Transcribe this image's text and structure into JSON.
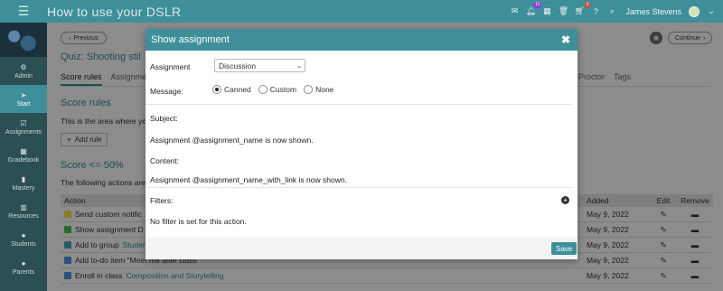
{
  "topbar": {
    "menu_icon": "hamburger-icon",
    "title": "How to use your DSLR",
    "mail_icon": "mail-icon",
    "notif_count": "11",
    "cart_count": "2",
    "user_name": "James Stevens"
  },
  "sidebar": {
    "items": [
      {
        "label": "Admin",
        "icon": "gear-icon"
      },
      {
        "label": "Start",
        "icon": "arrow-icon"
      },
      {
        "label": "Assignments",
        "icon": "checklist-icon"
      },
      {
        "label": "Gradebook",
        "icon": "grid-icon"
      },
      {
        "label": "Mastery",
        "icon": "bars-icon"
      },
      {
        "label": "Resources",
        "icon": "books-icon"
      },
      {
        "label": "Students",
        "icon": "person-icon"
      },
      {
        "label": "Parents",
        "icon": "person-icon"
      }
    ]
  },
  "main": {
    "prev_label": "Previous",
    "continue_label": "Continue",
    "quiz_title": "Quiz: Shooting stil",
    "tabs_left": [
      "Score rules",
      "Assignme"
    ],
    "tabs_right": [
      "Proctor",
      "Tags"
    ],
    "score_rules_title": "Score rules",
    "score_rules_desc": "This is the area where yo",
    "add_rule_label": "Add rule",
    "score_title": "Score <= 50%",
    "score_desc": "The following actions are",
    "table": {
      "headers": {
        "action": "Action",
        "added": "Added",
        "edit": "Edit",
        "remove": "Remove"
      },
      "rows": [
        {
          "text": "Send custom notific",
          "link": "",
          "added": "May 9, 2022",
          "icon_color": "#8a7a2a"
        },
        {
          "text": "Show assignment D",
          "link": "",
          "added": "May 9, 2022",
          "icon_color": "#2b6a2b"
        },
        {
          "text": "Add to group ",
          "link": "Studen",
          "added": "May 9, 2022",
          "icon_color": "#2a5a6a"
        },
        {
          "text": "Add to-do item \"Meet me after class \"",
          "link": "",
          "added": "May 9, 2022",
          "icon_color": "#2a4f7a"
        },
        {
          "text": "Enroll in class ",
          "link": "Composition and Storytelling",
          "added": "May 9, 2022",
          "icon_color": "#2a4f7a"
        }
      ]
    }
  },
  "modal": {
    "title": "Show assignment",
    "assignment_label": "Assignment",
    "assignment_value": "Discussion",
    "message_label": "Message:",
    "radio": {
      "canned": "Canned",
      "custom": "Custom",
      "none": "None",
      "selected": "Canned"
    },
    "subject_label": "Subject:",
    "subject_value": "Assignment @assignment_name is now shown.",
    "content_label": "Content:",
    "content_value": "Assignment @assignment_name_with_link is now shown.",
    "filters_label": "Filters:",
    "filters_value": "No filter is set for this action.",
    "save_label": "Save"
  }
}
